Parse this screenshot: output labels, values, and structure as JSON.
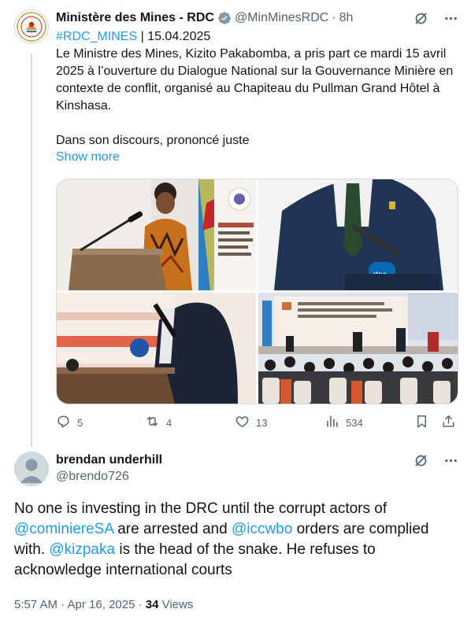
{
  "tweet": {
    "author_name": "Ministère des Mines - RDC",
    "handle": "@MinMinesRDC",
    "separator": "·",
    "time": "8h",
    "hashtag": "#RDC_MINES",
    "date_suffix": " | 15.04.2025",
    "paragraph1": "Le Ministre des Mines, Kizito Pakabomba, a pris part ce mardi 15 avril 2025 à l’ouverture du Dialogue National sur la Gouvernance Minière en contexte de conflit, organisé au Chapiteau du Pullman Grand Hôtel à Kinshasa.",
    "paragraph2": "Dans son discours, prononcé juste",
    "show_more": "Show more",
    "actions": {
      "replies": "5",
      "reposts": "4",
      "likes": "13",
      "views": "534"
    }
  },
  "reply": {
    "author_name": "brendan underhill",
    "handle": "@brendo726",
    "text_1": "No one is investing in the DRC until the corrupt actors of ",
    "mention_1": "@cominiereSA",
    "text_2": " are arrested and ",
    "mention_2": "@iccwbo",
    "text_3": " orders are complied with. ",
    "mention_3": "@kizpaka",
    "text_4": " is the head of the snake. He refuses to acknowledge international courts",
    "timestamp": "5:57 AM · Apr 16, 2025 · ",
    "views_count": "34",
    "views_label": " Views"
  },
  "colors": {
    "accent": "#1d9bf0",
    "text": "#0f1419",
    "muted": "#536471",
    "border": "#cfd9de"
  },
  "icons": [
    "grok-icon",
    "more-icon",
    "reply-icon",
    "repost-icon",
    "like-icon",
    "views-icon",
    "bookmark-icon",
    "share-icon",
    "verified-badge-icon"
  ]
}
